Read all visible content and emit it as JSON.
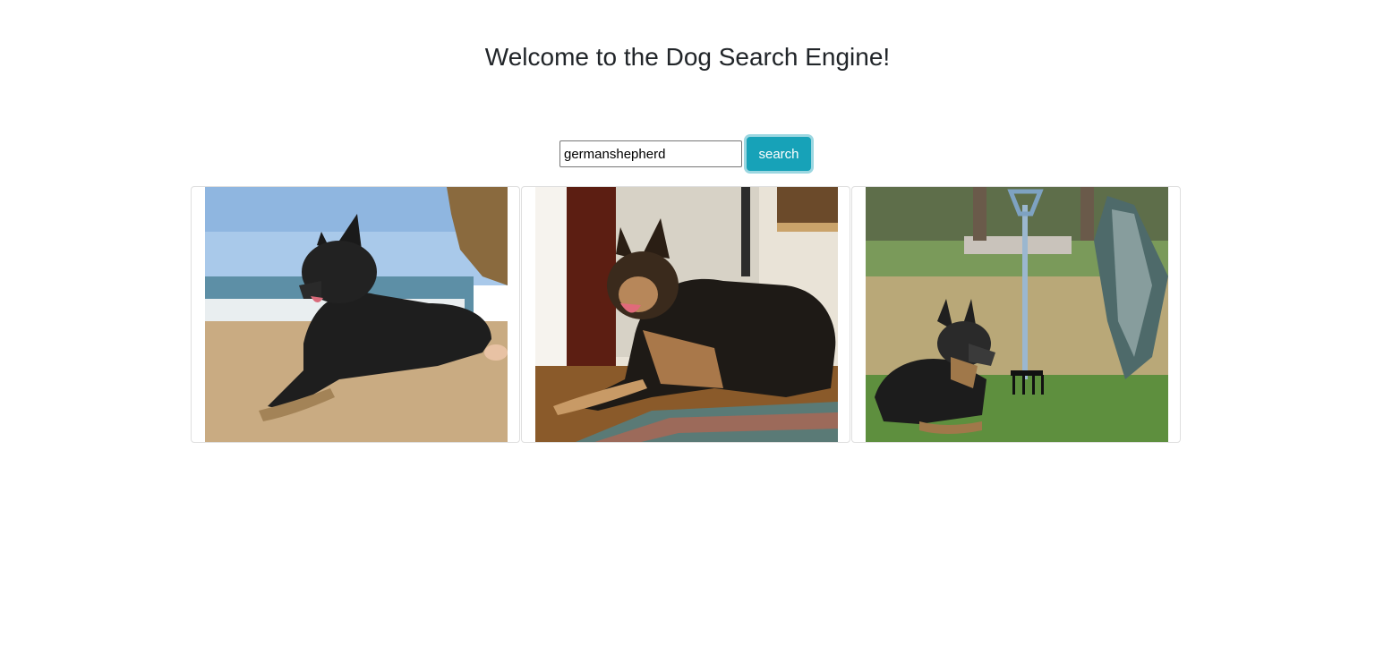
{
  "header": {
    "title": "Welcome to the Dog Search Engine!"
  },
  "search": {
    "value": "germanshepherd",
    "button_label": "search"
  },
  "colors": {
    "accent": "#17a2b8"
  },
  "results": [
    {
      "scene": "beach"
    },
    {
      "scene": "doorway"
    },
    {
      "scene": "garden"
    }
  ]
}
